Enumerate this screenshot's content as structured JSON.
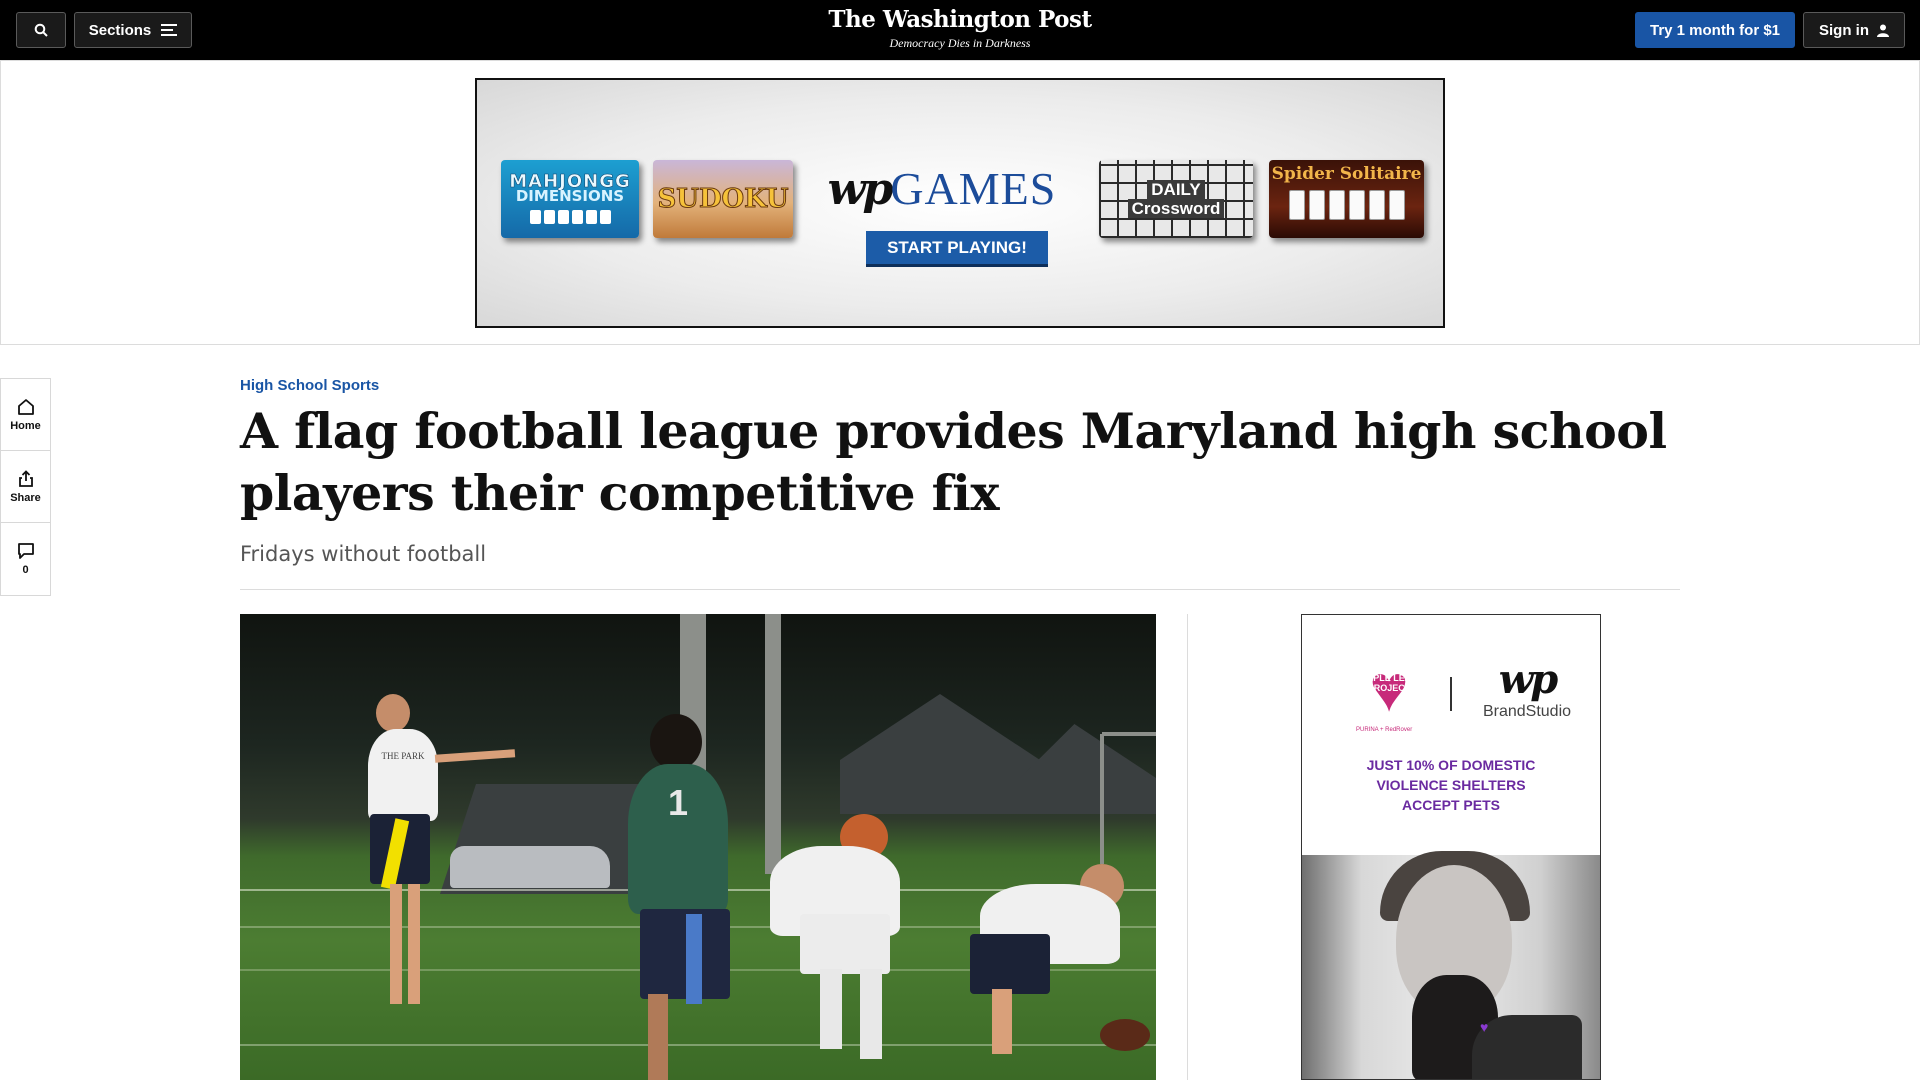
{
  "topbar": {
    "sections_label": "Sections",
    "masthead_title": "The Washington Post",
    "masthead_tagline": "Democracy Dies in Darkness",
    "subscribe_label": "Try 1 month for $1",
    "signin_label": "Sign in",
    "accent_color": "#1955a5"
  },
  "top_ad": {
    "tiles": [
      "MAHJONGG",
      "DIMENSIONS",
      "SUDOKU",
      "DAILY",
      "Crossword",
      "Spider Solitaire"
    ],
    "brand_wp": "wp",
    "brand_games": "GAMES",
    "cta": "START PLAYING!"
  },
  "rail": {
    "home_label": "Home",
    "share_label": "Share",
    "comments_count": "0"
  },
  "article": {
    "kicker": "High School Sports",
    "headline": "A flag football league provides Maryland high school players their competitive fix",
    "dek": "Fridays without football"
  },
  "photo": {
    "shirt_text": "THE PARK",
    "jersey_number": "1"
  },
  "side_ad": {
    "logo_text": "PURPLE LEASH PROJECT",
    "brand_wp": "wp",
    "brand_studio": "BrandStudio",
    "sponsor_text": "PURINA + RedRover",
    "message_line1": "JUST 10% OF DOMESTIC",
    "message_line2": "VIOLENCE SHELTERS",
    "message_line3": "ACCEPT PETS"
  }
}
